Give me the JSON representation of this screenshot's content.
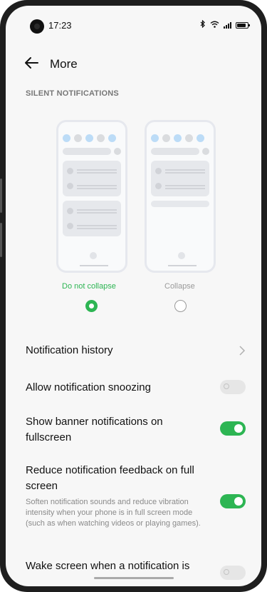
{
  "status": {
    "time": "17:23",
    "icons": [
      "bluetooth-icon",
      "wifi-icon",
      "signal-icon",
      "battery-icon"
    ]
  },
  "header": {
    "title": "More"
  },
  "section": {
    "title": "SILENT NOTIFICATIONS"
  },
  "options": [
    {
      "label": "Do not collapse",
      "selected": true,
      "color": "#2db553"
    },
    {
      "label": "Collapse",
      "selected": false,
      "color": "#9a9a9a"
    }
  ],
  "rows": [
    {
      "title": "Notification history",
      "control": "chevron"
    },
    {
      "title": "Allow notification snoozing",
      "control": "toggle",
      "on": false
    },
    {
      "title": "Show banner notifications on fullscreen",
      "control": "toggle",
      "on": true
    },
    {
      "title": "Reduce notification feedback on full screen",
      "subtitle": "Soften notification sounds and reduce vibration intensity when your phone is in full screen mode (such as when watching videos or playing games).",
      "control": "toggle",
      "on": true
    },
    {
      "title": "Wake screen when a notification is",
      "control": "toggle",
      "on": false
    }
  ],
  "accent": "#2db553"
}
